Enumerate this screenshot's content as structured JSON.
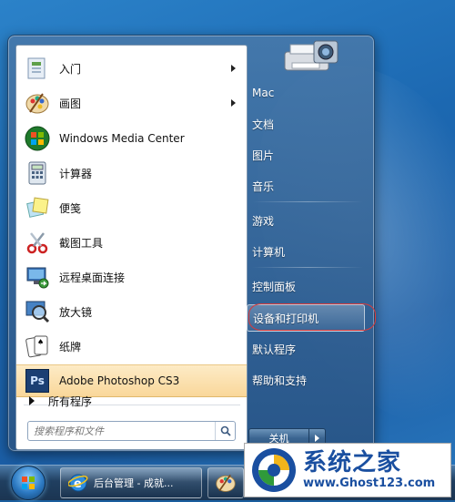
{
  "start_menu": {
    "pinned_items": [
      {
        "name": "getting-started",
        "label": "入门",
        "icon": "getting-started-icon",
        "has_submenu": true
      },
      {
        "name": "paint",
        "label": "画图",
        "icon": "paint-palette-icon",
        "has_submenu": true
      },
      {
        "name": "media-center",
        "label": "Windows Media Center",
        "icon": "windows-media-center-icon",
        "has_submenu": false
      },
      {
        "name": "calculator",
        "label": "计算器",
        "icon": "calculator-icon",
        "has_submenu": false
      },
      {
        "name": "sticky-notes",
        "label": "便笺",
        "icon": "sticky-notes-icon",
        "has_submenu": false
      },
      {
        "name": "snipping-tool",
        "label": "截图工具",
        "icon": "scissors-icon",
        "has_submenu": false
      },
      {
        "name": "remote-desktop",
        "label": "远程桌面连接",
        "icon": "remote-desktop-icon",
        "has_submenu": false
      },
      {
        "name": "magnifier",
        "label": "放大镜",
        "icon": "magnifier-icon",
        "has_submenu": false
      },
      {
        "name": "solitaire",
        "label": "纸牌",
        "icon": "playing-cards-icon",
        "has_submenu": false
      },
      {
        "name": "photoshop",
        "label": "Adobe Photoshop CS3",
        "icon": "photoshop-ps-icon",
        "has_submenu": false,
        "highlighted": true
      }
    ],
    "all_programs_label": "所有程序",
    "search_placeholder": "搜索程序和文件",
    "right_items": [
      {
        "name": "user",
        "label": "Mac"
      },
      {
        "name": "documents",
        "label": "文档"
      },
      {
        "name": "pictures",
        "label": "图片"
      },
      {
        "name": "music",
        "label": "音乐"
      },
      {
        "name": "games",
        "label": "游戏"
      },
      {
        "name": "computer",
        "label": "计算机"
      },
      {
        "name": "control-panel",
        "label": "控制面板"
      },
      {
        "name": "devices-printers",
        "label": "设备和打印机",
        "selected": true
      },
      {
        "name": "default-programs",
        "label": "默认程序"
      },
      {
        "name": "help-support",
        "label": "帮助和支持"
      }
    ],
    "shutdown_label": "关机"
  },
  "taskbar": {
    "start_orb": "windows-orb-icon",
    "buttons": [
      {
        "name": "ie-task",
        "label": "后台管理 - 成就...",
        "icon": "internet-explorer-icon"
      },
      {
        "name": "paint-task",
        "label": "",
        "icon": "paint-palette-icon"
      }
    ]
  },
  "watermark": {
    "title": "系统之家",
    "url": "www.Ghost123.com"
  },
  "colors": {
    "highlight": "#f9d79a",
    "selection_ring": "#d93a3a",
    "menu_blue": "#3b6591",
    "watermark_blue": "#1a4fa0"
  }
}
